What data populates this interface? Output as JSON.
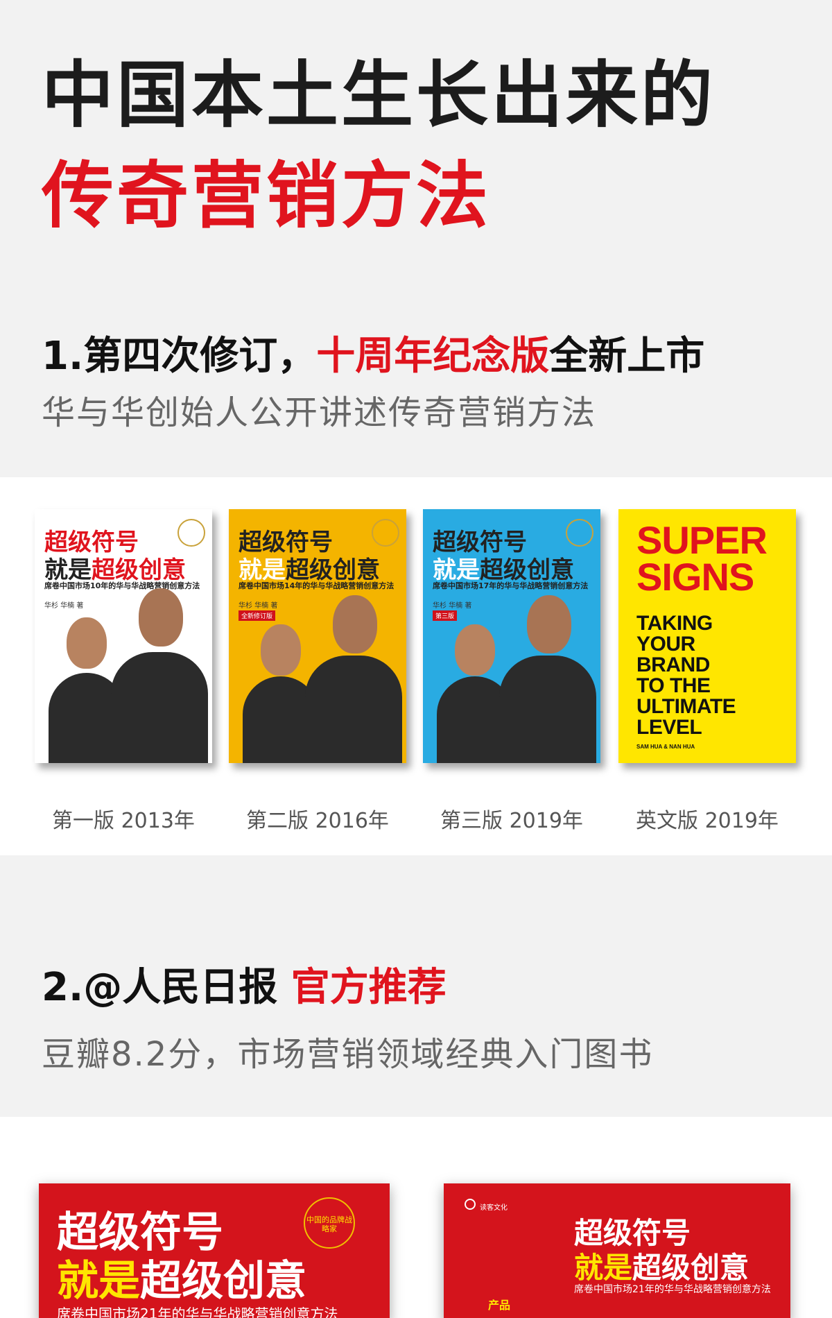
{
  "hero": {
    "line1": "中国本土生长出来的",
    "line2": "传奇营销方法"
  },
  "section1": {
    "head_prefix": "1.第四次修订，",
    "head_highlight": "十周年纪念版",
    "head_suffix": "全新上市",
    "subtitle": "华与华创始人公开讲述传奇营销方法"
  },
  "editions": [
    {
      "caption": "第一版 2013年",
      "cover_color": "#ffffff",
      "cover_line1": "超级符号",
      "cover_line2a": "就是",
      "cover_line2b": "超级创意",
      "cover_sub": "席卷中国市场10年的华与华战略营销创意方法",
      "authors": "华杉 华楠 著"
    },
    {
      "caption": "第二版 2016年",
      "cover_color": "#f4b400",
      "cover_line1": "超级符号",
      "cover_line2a": "就是",
      "cover_line2b": "超级创意",
      "cover_sub": "席卷中国市场14年的华与华战略营销创意方法",
      "authors": "华杉 华楠 著",
      "edition_tag": "全新修订版"
    },
    {
      "caption": "第三版 2019年",
      "cover_color": "#29abe2",
      "cover_line1": "超级符号",
      "cover_line2a": "就是",
      "cover_line2b": "超级创意",
      "cover_sub": "席卷中国市场17年的华与华战略营销创意方法",
      "authors": "华杉 华楠 著",
      "edition_tag": "第三版"
    },
    {
      "caption": "英文版 2019年",
      "cover_color": "#ffe600",
      "eng_title_1": "SUPER",
      "eng_title_2": "SIGNS",
      "eng_sub_1": "TAKING",
      "eng_sub_2": "YOUR",
      "eng_sub_3": "BRAND",
      "eng_sub_4": "TO THE",
      "eng_sub_5": "ULTIMATE",
      "eng_sub_6": "LEVEL",
      "eng_authors": "SAM HUA & NAN HUA"
    }
  ],
  "section2": {
    "head_prefix": "2.@人民日报 ",
    "head_highlight": "官方推荐",
    "subtitle": "豆瓣8.2分，市场营销领域经典入门图书"
  },
  "bottom_books": [
    {
      "line1": "超级符号",
      "line2a": "就是",
      "line2b": "超级创意",
      "sub": "席卷中国市场21年的华与华战略营销创意方法",
      "badge": "中国的品牌战略家"
    },
    {
      "line1": "超级符号",
      "line2a": "就是",
      "line2b": "超级创意",
      "sub": "席卷中国市场21年的华与华战略营销创意方法",
      "label": "产品",
      "publisher": "读客文化"
    }
  ],
  "colors": {
    "accent_red": "#e0141e",
    "text_dark": "#1c1c1c",
    "text_gray": "#666666",
    "band_bg": "#f2f2f2"
  }
}
